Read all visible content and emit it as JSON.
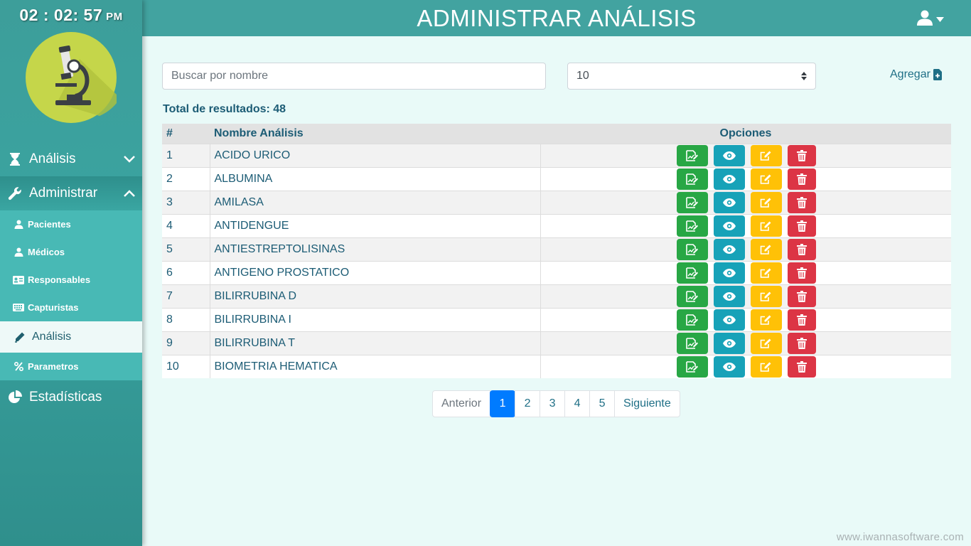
{
  "clock": {
    "time": "02 : 02: 57",
    "ampm": "PM"
  },
  "sidebar": {
    "analisis_label": "Análisis",
    "administrar_label": "Administrar",
    "estadisticas_label": "Estadísticas",
    "submenu": [
      {
        "label": "Pacientes",
        "icon": "user-icon"
      },
      {
        "label": "Médicos",
        "icon": "user-icon"
      },
      {
        "label": "Responsables",
        "icon": "id-card-icon"
      },
      {
        "label": "Capturistas",
        "icon": "keyboard-icon"
      },
      {
        "label": "Análisis",
        "icon": "pencil-icon",
        "active": true
      },
      {
        "label": "Parametros",
        "icon": "percent-icon"
      }
    ]
  },
  "header": {
    "title": "ADMINISTRAR ANÁLISIS"
  },
  "search": {
    "placeholder": "Buscar por nombre",
    "value": ""
  },
  "page_size": {
    "value": "10"
  },
  "add": {
    "label": "Agregar"
  },
  "total": {
    "label": "Total de resultados: 48"
  },
  "table": {
    "headers": [
      "#",
      "Nombre Análisis",
      "Opciones"
    ],
    "rows": [
      {
        "n": "1",
        "name": "ACIDO URICO"
      },
      {
        "n": "2",
        "name": "ALBUMINA"
      },
      {
        "n": "3",
        "name": "AMILASA"
      },
      {
        "n": "4",
        "name": "ANTIDENGUE"
      },
      {
        "n": "5",
        "name": "ANTIESTREPTOLISINAS"
      },
      {
        "n": "6",
        "name": "ANTIGENO PROSTATICO"
      },
      {
        "n": "7",
        "name": "BILIRRUBINA D"
      },
      {
        "n": "8",
        "name": "BILIRRUBINA I"
      },
      {
        "n": "9",
        "name": "BILIRRUBINA T"
      },
      {
        "n": "10",
        "name": "BIOMETRIA HEMATICA"
      }
    ]
  },
  "pagination": {
    "prev": "Anterior",
    "pages": [
      "1",
      "2",
      "3",
      "4",
      "5"
    ],
    "next": "Siguiente",
    "active": "1"
  },
  "footer": {
    "text": "www.iwannasoftware.com"
  },
  "colors": {
    "sidebar": "#3d9e9a",
    "topbar": "#42a3a0",
    "background": "#e9faf8",
    "green": "#28a745",
    "cyan": "#17a2b8",
    "yellow": "#ffc107",
    "red": "#dc3545",
    "primary": "#007bff"
  }
}
